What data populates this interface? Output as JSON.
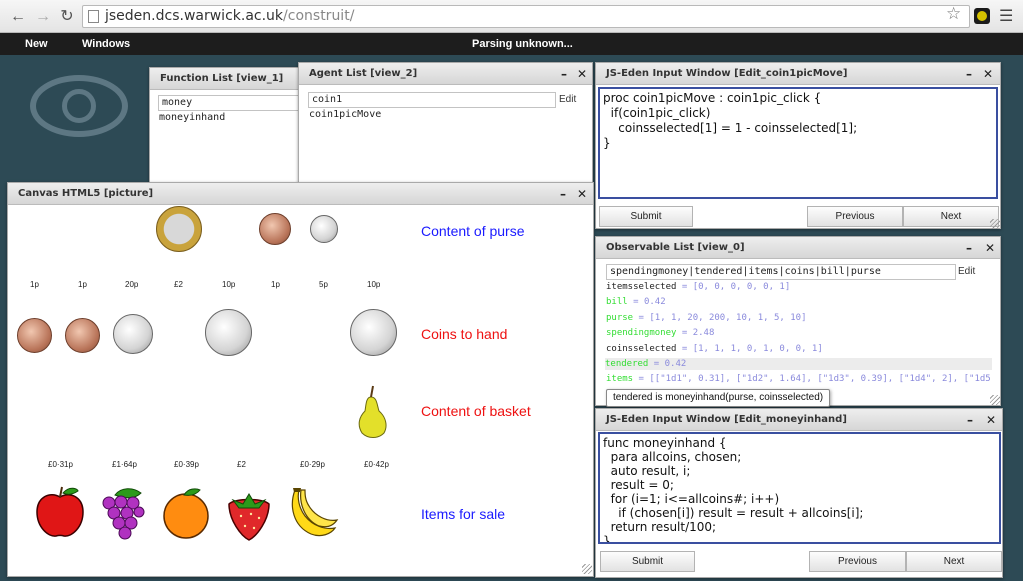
{
  "browser": {
    "url_host": "jseden.dcs.warwick.ac.uk",
    "url_path": "/construit/"
  },
  "menubar": {
    "items": [
      "New",
      "Windows"
    ],
    "status": "Parsing unknown..."
  },
  "function_list": {
    "title": "Function List [view_1]",
    "search_value": "money",
    "items": [
      "moneyinhand"
    ]
  },
  "agent_list": {
    "title": "Agent List [view_2]",
    "search_value": "coin1",
    "edit_label": "Edit",
    "items": [
      "coin1picMove"
    ]
  },
  "input_window_1": {
    "title": "JS-Eden Input Window [Edit_coin1picMove]",
    "code": "proc coin1picMove : coin1pic_click {\n  if(coin1pic_click)\n    coinsselected[1] = 1 - coinsselected[1];\n}",
    "submit_label": "Submit",
    "previous_label": "Previous",
    "next_label": "Next"
  },
  "canvas": {
    "title": "Canvas HTML5 [picture]",
    "headings": {
      "purse": "Content of purse",
      "hand": "Coins to hand",
      "basket": "Content of basket",
      "sale": "Items for sale"
    },
    "purse_labels": [
      "1p",
      "1p",
      "20p",
      "£2",
      "10p",
      "1p",
      "5p",
      "10p"
    ],
    "price_labels": [
      "£0·31p",
      "£1·64p",
      "£0·39p",
      "£2",
      "£0·29p",
      "£0·42p"
    ]
  },
  "observable_list": {
    "title": "Observable List [view_0]",
    "search_value": "spendingmoney|tendered|items|coins|bill|purse",
    "edit_label": "Edit",
    "rows": [
      {
        "name": "itemsselected",
        "value": "= [0, 0, 0, 0, 0, 1]"
      },
      {
        "name": "bill",
        "value": "= 0.42"
      },
      {
        "name": "purse",
        "value": "= [1, 1, 20, 200, 10, 1, 5, 10]"
      },
      {
        "name": "spendingmoney",
        "value": "= 2.48"
      },
      {
        "name": "coinsselected",
        "value": "= [1, 1, 1, 0, 1, 0, 0, 1]"
      },
      {
        "name": "tendered",
        "value": "= 0.42"
      },
      {
        "name": "items",
        "value": "= [[\"1d1\", 0.31], [\"1d2\", 1.64], [\"1d3\", 0.39], [\"1d4\", 2], [\"1d5\", 0.29],"
      }
    ],
    "tooltip": "tendered is moneyinhand(purse, coinsselected)"
  },
  "input_window_2": {
    "title": "JS-Eden Input Window [Edit_moneyinhand]",
    "code": "func moneyinhand {\n  para allcoins, chosen;\n  auto result, i;\n  result = 0;\n  for (i=1; i<=allcoins#; i++)\n    if (chosen[i]) result = result + allcoins[i];\n  return result/100;\n}",
    "submit_label": "Submit",
    "previous_label": "Previous",
    "next_label": "Next"
  },
  "colors": {
    "desktop": "#2d4a55",
    "menubar": "#1d1d1d",
    "heading_blue": "#1a1aff",
    "heading_red": "#ee1111",
    "editor_border": "#3a4fa0",
    "observable_green": "#33dd33"
  }
}
